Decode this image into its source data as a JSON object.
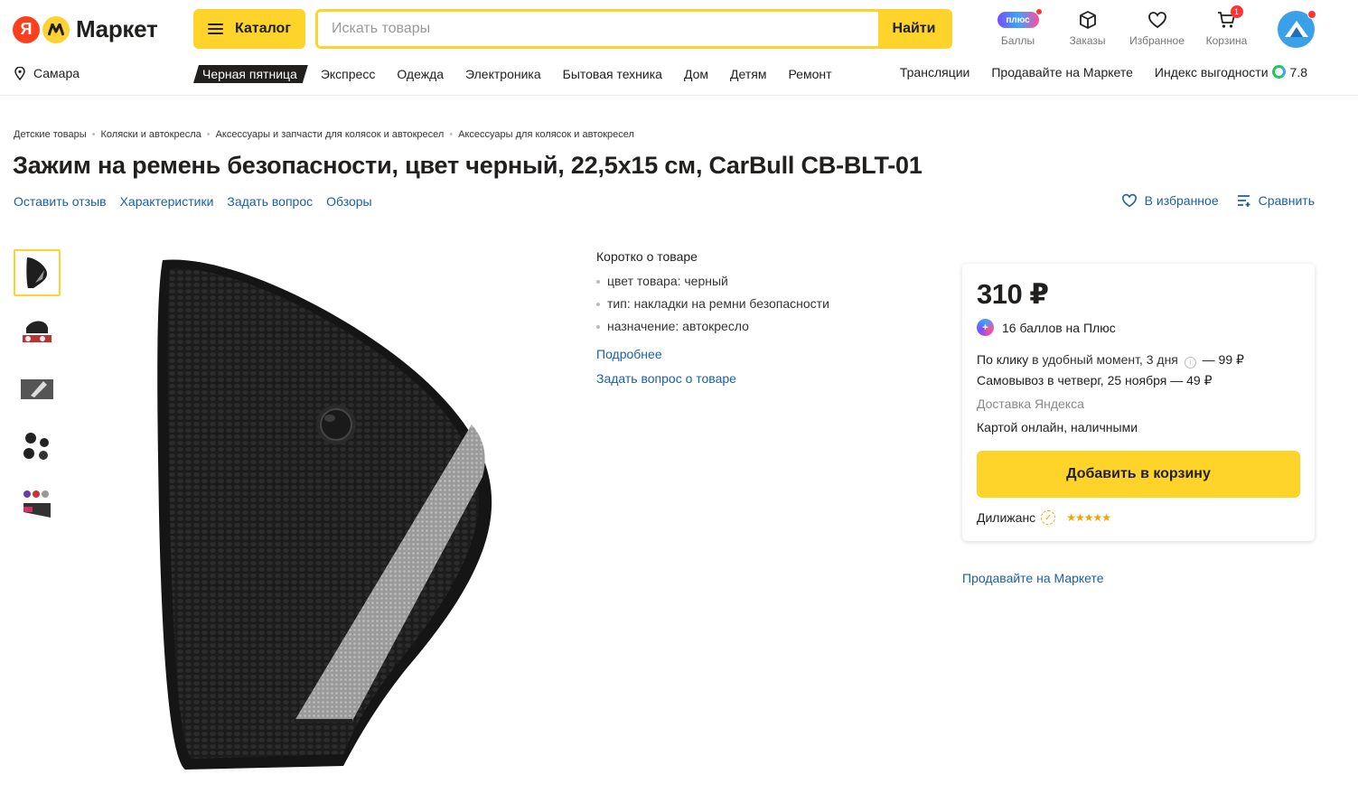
{
  "header": {
    "logo_ya": "Я",
    "logo_text": "Маркет",
    "catalog_label": "Каталог",
    "search_placeholder": "Искать товары",
    "search_button": "Найти",
    "plus_badge": "плюс",
    "icons": [
      {
        "label": "Баллы",
        "icon": "plus-icon"
      },
      {
        "label": "Заказы",
        "icon": "box-icon"
      },
      {
        "label": "Избранное",
        "icon": "heart-icon"
      },
      {
        "label": "Корзина",
        "icon": "cart-icon",
        "count": "1"
      }
    ],
    "accent_color": "#fed42b"
  },
  "nav": {
    "location": "Самара",
    "items": [
      "Черная пятница",
      "Экспресс",
      "Одежда",
      "Электроника",
      "Бытовая техника",
      "Дом",
      "Детям",
      "Ремонт"
    ],
    "right": [
      "Трансляции",
      "Продавайте на Маркете",
      "Индекс выгодности"
    ],
    "index_value": "7.8"
  },
  "breadcrumbs": [
    "Детские товары",
    "Коляски и автокресла",
    "Аксессуары и запчасти для колясок и автокресел",
    "Аксессуары для колясок и автокресел"
  ],
  "product": {
    "title": "Зажим на ремень безопасности, цвет черный, 22,5x15 см, CarBull CB-BLT-01",
    "links": [
      "Оставить отзыв",
      "Характеристики",
      "Задать вопрос",
      "Обзоры"
    ],
    "favorite": "В избранное",
    "compare": "Сравнить"
  },
  "short_info": {
    "heading": "Коротко о товаре",
    "specs": [
      "цвет товара: черный",
      "тип: накладки на ремни безопасности",
      "назначение: автокресло"
    ],
    "more": "Подробнее",
    "ask": "Задать вопрос о товаре"
  },
  "buybox": {
    "price": "310 ₽",
    "bonus": "16 баллов на Плюс",
    "delivery_click_strong": "По клику",
    "delivery_click_rest": " в удобный момент, 3 дня",
    "delivery_click_price": "— 99 ₽",
    "pickup": "Самовывоз в четверг, 25 ноября — 49 ₽",
    "delivery_service": "Доставка Яндекса",
    "payment": "Картой онлайн, наличными",
    "add_to_cart": "Добавить в корзину",
    "seller": "Дилижанс",
    "rating_stars": 5
  },
  "sell_link": "Продавайте на Маркете"
}
